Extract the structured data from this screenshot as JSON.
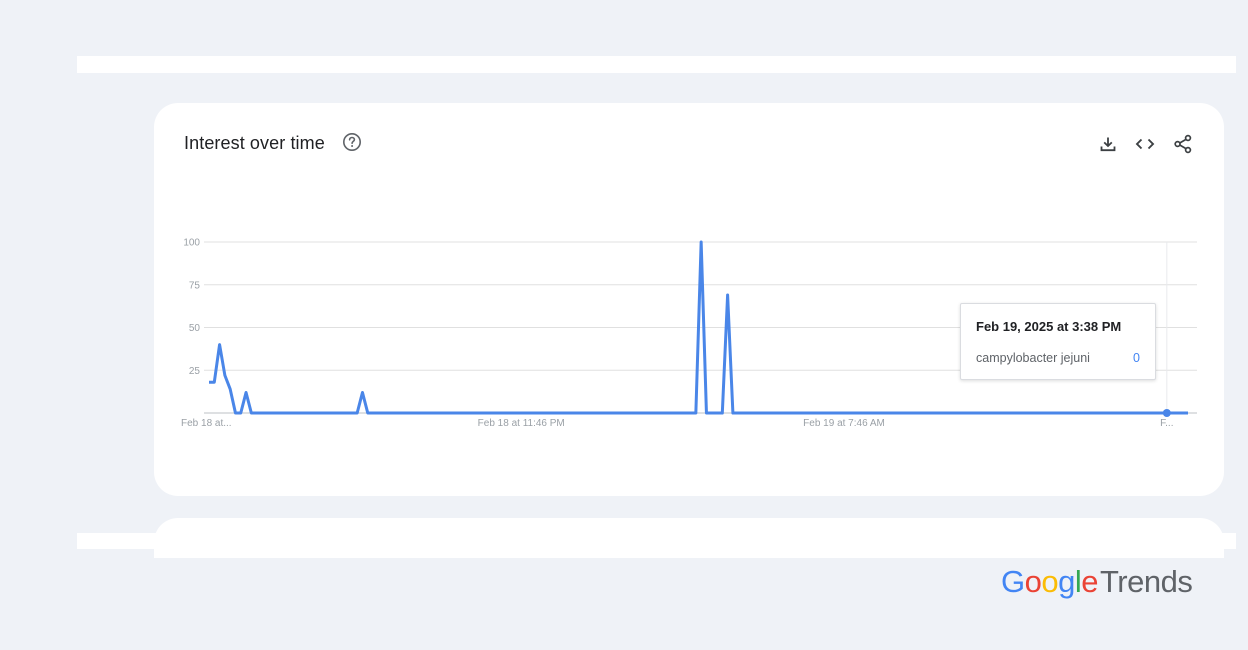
{
  "card": {
    "title": "Interest over time"
  },
  "icons": {
    "help": "help-circle-icon",
    "download": "download-icon",
    "embed": "code-embed-icon",
    "share": "share-icon"
  },
  "tooltip": {
    "date": "Feb 19, 2025 at 3:38 PM",
    "term": "campylobacter jejuni",
    "value": "0"
  },
  "logo": {
    "brand_letters": [
      "G",
      "o",
      "o",
      "g",
      "l",
      "e"
    ],
    "product": "Trends"
  },
  "colors": {
    "line": "#4a86e8",
    "page_background": "#eff2f7",
    "card_background": "#ffffff",
    "grid": "#e0e0e0",
    "axis_text": "#9aa0a6"
  },
  "chart_data": {
    "type": "line",
    "series": [
      {
        "name": "campylobacter jejuni",
        "values": [
          18,
          18,
          40,
          22,
          14,
          0,
          0,
          12,
          0,
          0,
          0,
          0,
          0,
          0,
          0,
          0,
          0,
          0,
          0,
          0,
          0,
          0,
          0,
          0,
          0,
          0,
          0,
          0,
          0,
          12,
          0,
          0,
          0,
          0,
          0,
          0,
          0,
          0,
          0,
          0,
          0,
          0,
          0,
          0,
          0,
          0,
          0,
          0,
          0,
          0,
          0,
          0,
          0,
          0,
          0,
          0,
          0,
          0,
          0,
          0,
          0,
          0,
          0,
          0,
          0,
          0,
          0,
          0,
          0,
          0,
          0,
          0,
          0,
          0,
          0,
          0,
          0,
          0,
          0,
          0,
          0,
          0,
          0,
          0,
          0,
          0,
          0,
          0,
          0,
          0,
          0,
          0,
          0,
          100,
          0,
          0,
          0,
          0,
          69,
          0,
          0,
          0,
          0,
          0,
          0,
          0,
          0,
          0,
          0,
          0,
          0,
          0,
          0,
          0,
          0,
          0,
          0,
          0,
          0,
          0,
          0,
          0,
          0,
          0,
          0,
          0,
          0,
          0,
          0,
          0,
          0,
          0,
          0,
          0,
          0,
          0,
          0,
          0,
          0,
          0,
          0,
          0,
          0,
          0,
          0,
          0,
          0,
          0,
          0,
          0,
          0,
          0,
          0,
          0,
          0,
          0,
          0,
          0,
          0,
          0,
          0,
          0,
          0,
          0,
          0,
          0,
          0,
          0,
          0,
          0,
          0,
          0,
          0,
          0,
          0,
          0,
          0,
          0,
          0,
          0,
          0,
          0,
          0,
          0,
          0,
          0
        ]
      }
    ],
    "yticks": [
      100,
      75,
      50,
      25
    ],
    "ylim": [
      0,
      100
    ],
    "xtick_labels": [
      {
        "label": "Feb 18 at...",
        "index": 0
      },
      {
        "label": "Feb 18 at 11:46 PM",
        "index": 59
      },
      {
        "label": "Feb 19 at 7:46 AM",
        "index": 120
      },
      {
        "label": "F...",
        "index": 181
      }
    ],
    "highlight_index": 181,
    "grid": true
  }
}
